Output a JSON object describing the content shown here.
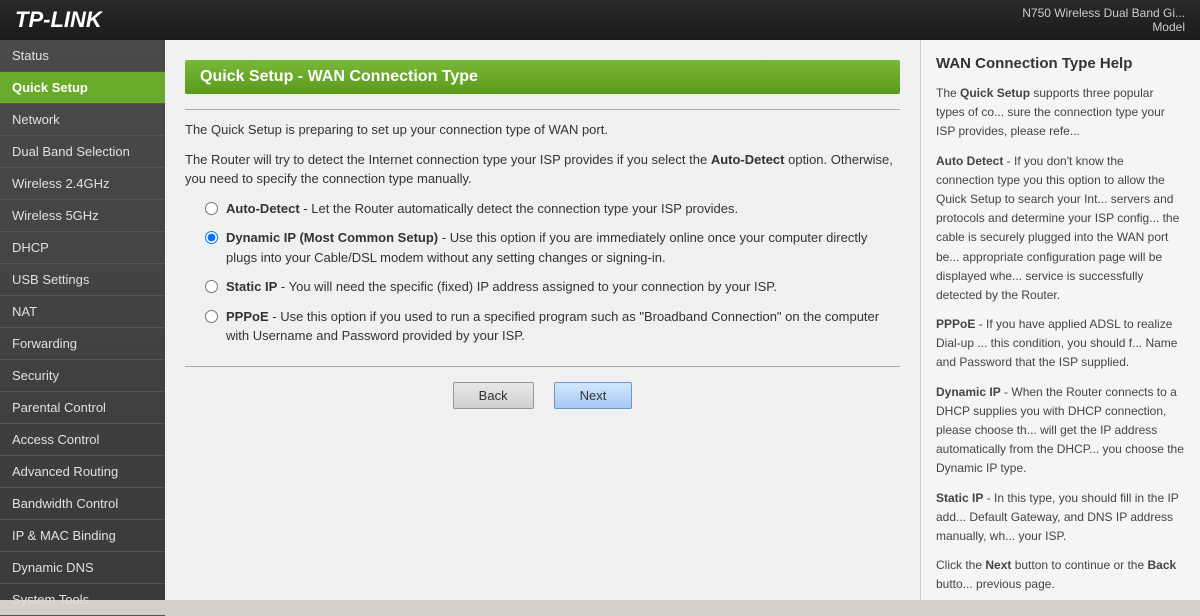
{
  "header": {
    "logo": "TP-LINK",
    "model_info": "N750 Wireless Dual Band Gi...\nModel "
  },
  "sidebar": {
    "items": [
      {
        "label": "Status",
        "active": false
      },
      {
        "label": "Quick Setup",
        "active": true
      },
      {
        "label": "Network",
        "active": false
      },
      {
        "label": "Dual Band Selection",
        "active": false
      },
      {
        "label": "Wireless 2.4GHz",
        "active": false
      },
      {
        "label": "Wireless 5GHz",
        "active": false
      },
      {
        "label": "DHCP",
        "active": false
      },
      {
        "label": "USB Settings",
        "active": false
      },
      {
        "label": "NAT",
        "active": false
      },
      {
        "label": "Forwarding",
        "active": false
      },
      {
        "label": "Security",
        "active": false
      },
      {
        "label": "Parental Control",
        "active": false
      },
      {
        "label": "Access Control",
        "active": false
      },
      {
        "label": "Advanced Routing",
        "active": false
      },
      {
        "label": "Bandwidth Control",
        "active": false
      },
      {
        "label": "IP & MAC Binding",
        "active": false
      },
      {
        "label": "Dynamic DNS",
        "active": false
      },
      {
        "label": "System Tools",
        "active": false
      }
    ]
  },
  "main": {
    "page_title": "Quick Setup - WAN Connection Type",
    "intro1": "The Quick Setup is preparing to set up your connection type of WAN port.",
    "intro2": "The Router will try to detect the Internet connection type your ISP provides if you select the Auto-Detect option. Otherwise, you need to specify the connection type manually.",
    "options": [
      {
        "id": "auto-detect",
        "checked": false,
        "bold_part": "Auto-Detect",
        "rest": " - Let the Router automatically detect the connection type your ISP provides."
      },
      {
        "id": "dynamic-ip",
        "checked": true,
        "bold_part": "Dynamic IP (Most Common Setup)",
        "rest": " - Use this option if you are immediately online once your computer directly plugs into your Cable/DSL modem without any setting changes or signing-in."
      },
      {
        "id": "static-ip",
        "checked": false,
        "bold_part": "Static IP",
        "rest": " - You will need the specific (fixed) IP address assigned to your connection by your ISP."
      },
      {
        "id": "pppoe",
        "checked": false,
        "bold_part": "PPPoE",
        "rest": " - Use this option if you used to run a specified program such as \"Broadband Connection\" on the computer with Username and Password provided by your ISP."
      }
    ],
    "buttons": {
      "back": "Back",
      "next": "Next"
    }
  },
  "help": {
    "title": "WAN Connection Type Help",
    "paragraphs": [
      "The Quick Setup supports three popular types of co... sure the connection type your ISP provides, please refe...",
      "Auto Detect - If you don't know the connection type you this option to allow the Quick Setup to search your Int... servers and protocols and determine your ISP config... the cable is securely plugged into the WAN port be... appropriate configuration page will be displayed whe... service is successfully detected by the Router.",
      "PPPoE - If you have applied ADSL to realize Dial-up ... this condition, you should f... Name and Password that the ISP supplied.",
      "Dynamic IP - When the Router connects to a DHCP supplies you with DHCP connection, please choose th... will get the IP address automatically from the DHCP... you choose the Dynamic IP type.",
      "Static IP - In this type, you should fill in the IP add... Default Gateway, and DNS IP address manually, wh... your ISP.",
      "Click the Next button to continue or the Back butto... previous page."
    ]
  }
}
